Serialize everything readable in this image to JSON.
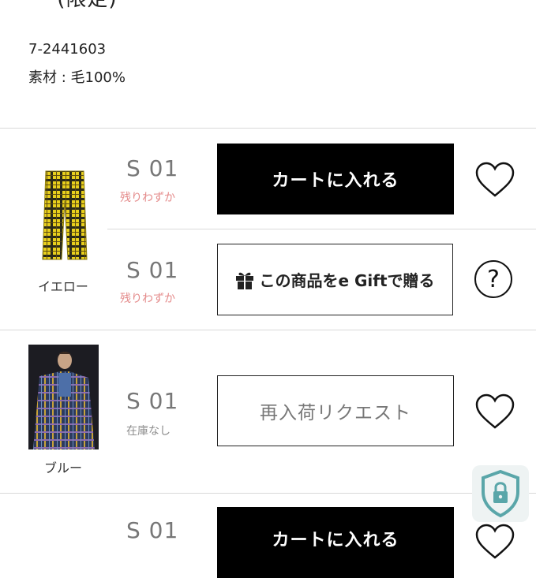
{
  "product": {
    "title_fragment": "(限定)",
    "code": "7-2441603",
    "material": "素材 : 毛100%"
  },
  "variants": [
    {
      "color": "イエロー",
      "rows": [
        {
          "size": "S 01",
          "stock": "残りわずか",
          "action": "カートに入れる",
          "side": "heart-icon"
        },
        {
          "size": "S 01",
          "stock": "残りわずか",
          "action": "この商品をe Giftで贈る",
          "side": "help-icon"
        }
      ]
    },
    {
      "color": "ブルー",
      "rows": [
        {
          "size": "S 01",
          "stock": "在庫なし",
          "action": "再入荷リクエスト",
          "side": "heart-icon"
        }
      ]
    },
    {
      "color": "",
      "rows": [
        {
          "size": "S 01",
          "stock": "",
          "action": "カートに入れる",
          "side": "heart-icon"
        }
      ]
    }
  ],
  "help_symbol": "?",
  "colors": {
    "cart_button_bg": "#000000",
    "low_stock_text": "#e48a8a",
    "out_of_stock_text": "#8d8d8d",
    "divider": "#d9d9d9",
    "shield": "#5aa6a9"
  }
}
